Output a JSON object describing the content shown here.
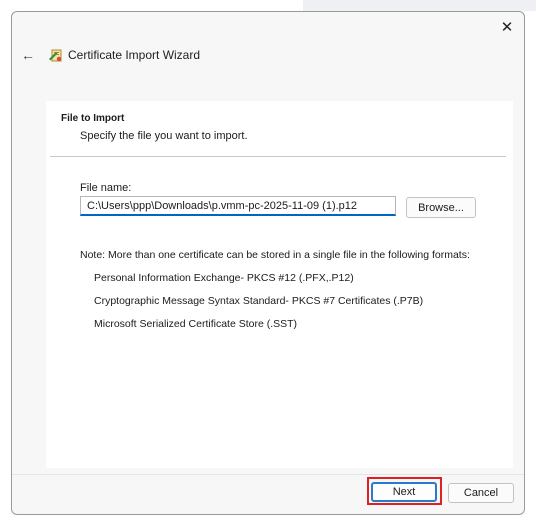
{
  "window": {
    "title": "Certificate Import Wizard",
    "close_glyph": "✕",
    "back_glyph": "←"
  },
  "page": {
    "heading": "File to Import",
    "subheading": "Specify the file you want to import.",
    "file_label": "File name:",
    "file_value": "C:\\Users\\ppp\\Downloads\\p.vmm-pc-2025-11-09 (1).p12",
    "browse_label": "Browse...",
    "note": "Note:  More than one certificate can be stored in a single file in the following formats:",
    "formats": [
      "Personal Information Exchange- PKCS #12 (.PFX,.P12)",
      "Cryptographic Message Syntax Standard- PKCS #7 Certificates (.P7B)",
      "Microsoft Serialized Certificate Store (.SST)"
    ]
  },
  "footer": {
    "next_label": "Next",
    "cancel_label": "Cancel"
  },
  "colors": {
    "accent": "#0067c0",
    "highlight": "#e01e25"
  },
  "icons": {
    "wizard": "certificate-wizard-icon",
    "back": "back-arrow-icon",
    "close": "close-icon"
  }
}
